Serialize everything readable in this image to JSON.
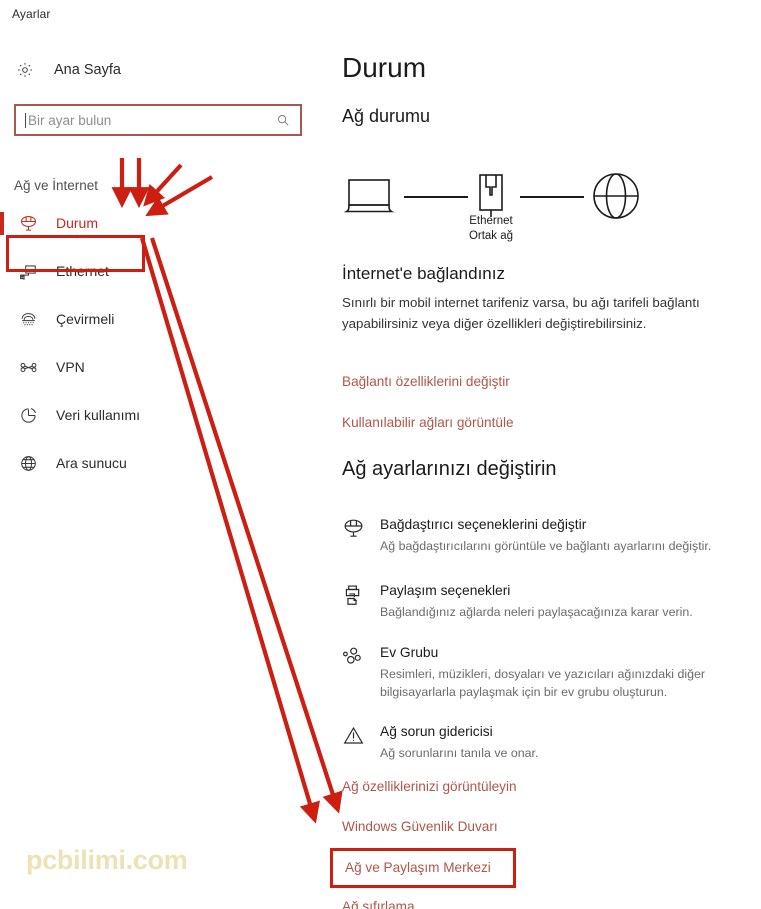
{
  "window": {
    "title": "Ayarlar"
  },
  "sidebar": {
    "home": {
      "label": "Ana Sayfa",
      "icon": "gear-icon"
    },
    "search": {
      "value": "",
      "placeholder": "Bir ayar bulun",
      "icon": "search-icon"
    },
    "section_label": "Ağ ve İnternet",
    "items": [
      {
        "label": "Durum",
        "icon": "status-globe-icon",
        "active": true
      },
      {
        "label": "Ethernet",
        "icon": "ethernet-icon",
        "active": false
      },
      {
        "label": "Çevirmeli",
        "icon": "dialup-icon",
        "active": false
      },
      {
        "label": "VPN",
        "icon": "vpn-icon",
        "active": false
      },
      {
        "label": "Veri kullanımı",
        "icon": "data-usage-icon",
        "active": false
      },
      {
        "label": "Ara sunucu",
        "icon": "proxy-globe-icon",
        "active": false
      }
    ]
  },
  "main": {
    "page_title": "Durum",
    "section_title": "Ağ durumu",
    "diagram": {
      "device_icon": "laptop-icon",
      "adapter_icon": "ethernet-port-icon",
      "internet_icon": "globe-icon",
      "caption_line1": "Ethernet",
      "caption_line2": "Ortak ağ"
    },
    "connection_status": "İnternet'e bağlandınız",
    "connection_desc": "Sınırlı bir mobil internet tarifeniz varsa, bu ağı tarifeli bağlantı yapabilirsiniz veya diğer özellikleri değiştirebilirsiniz.",
    "links_top": [
      "Bağlantı özelliklerini değiştir",
      "Kullanılabilir ağları görüntüle"
    ],
    "change_settings_title": "Ağ ayarlarınızı değiştirin",
    "options": [
      {
        "icon": "adapter-globe-icon",
        "title": "Bağdaştırıcı seçeneklerini değiştir",
        "sub": "Ağ bağdaştırıcılarını görüntüle ve bağlantı ayarlarını değiştir."
      },
      {
        "icon": "sharing-printer-icon",
        "title": "Paylaşım seçenekleri",
        "sub": "Bağlandığınız ağlarda neleri paylaşacağınıza karar verin."
      },
      {
        "icon": "homegroup-icon",
        "title": "Ev Grubu",
        "sub": "Resimleri, müzikleri, dosyaları ve yazıcıları ağınızdaki diğer bilgisayarlarla paylaşmak için bir ev grubu oluşturun."
      },
      {
        "icon": "warning-triangle-icon",
        "title": "Ağ sorun gidericisi",
        "sub": "Ağ sorunlarını tanıla ve onar."
      }
    ],
    "links_bottom": [
      "Ağ özelliklerinizi görüntüleyin",
      "Windows Güvenlik Duvarı",
      "Ağ ve Paylaşım Merkezi",
      "Ağ sıfırlama"
    ]
  },
  "watermark": {
    "text": "pcbilimi.com"
  },
  "annotations": {
    "highlight_color": "#cc1f12",
    "arrow_color": "#cc1f12",
    "link_color": "#b15648",
    "accent_color": "#c62a1c",
    "watermark_color": "#ece2b6"
  }
}
